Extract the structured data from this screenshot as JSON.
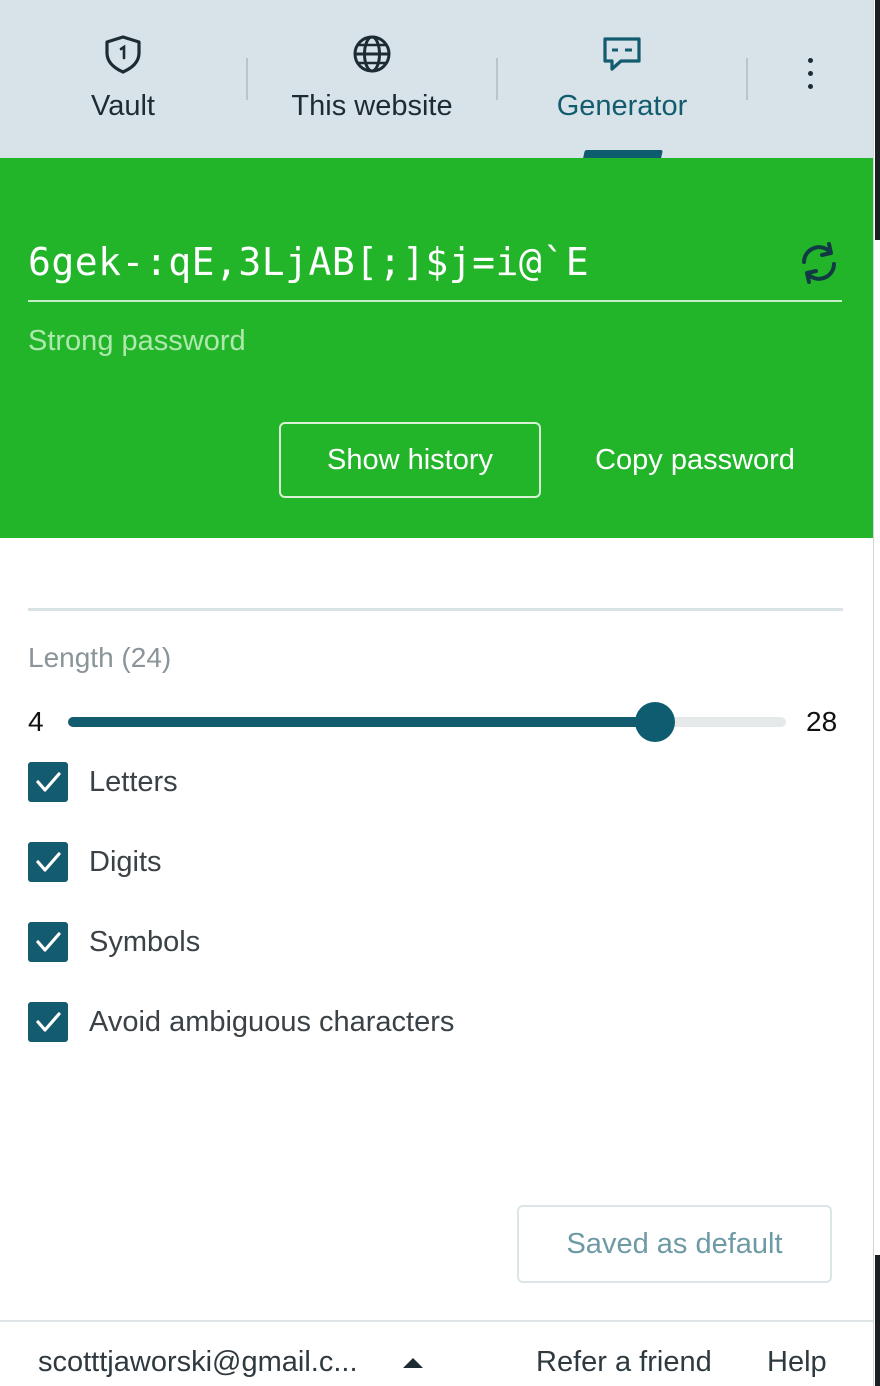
{
  "tabs": [
    {
      "label": "Vault",
      "icon": "shield-icon",
      "active": false
    },
    {
      "label": "This website",
      "icon": "globe-icon",
      "active": false
    },
    {
      "label": "Generator",
      "icon": "chat-icon",
      "active": true
    }
  ],
  "menu_icon": "kebab-menu-icon",
  "generator": {
    "password": "6gek-:qE,3LjAB[;]$j=i@`E",
    "strength": "Strong password",
    "show_history_label": "Show history",
    "copy_label": "Copy password",
    "refresh_icon": "refresh-icon",
    "accent_color": "#22b52a"
  },
  "length": {
    "label": "Length (24)",
    "min": "4",
    "max": "28",
    "value": 24
  },
  "options": [
    {
      "label": "Letters",
      "checked": true
    },
    {
      "label": "Digits",
      "checked": true
    },
    {
      "label": "Symbols",
      "checked": true
    },
    {
      "label": "Avoid ambiguous characters",
      "checked": true
    }
  ],
  "saved_default_label": "Saved as default",
  "footer": {
    "account": "scotttjaworski@gmail.c...",
    "refer": "Refer a friend",
    "help": "Help"
  },
  "colors": {
    "primary": "#135b6e",
    "tab_bg": "#d7e3e8"
  }
}
